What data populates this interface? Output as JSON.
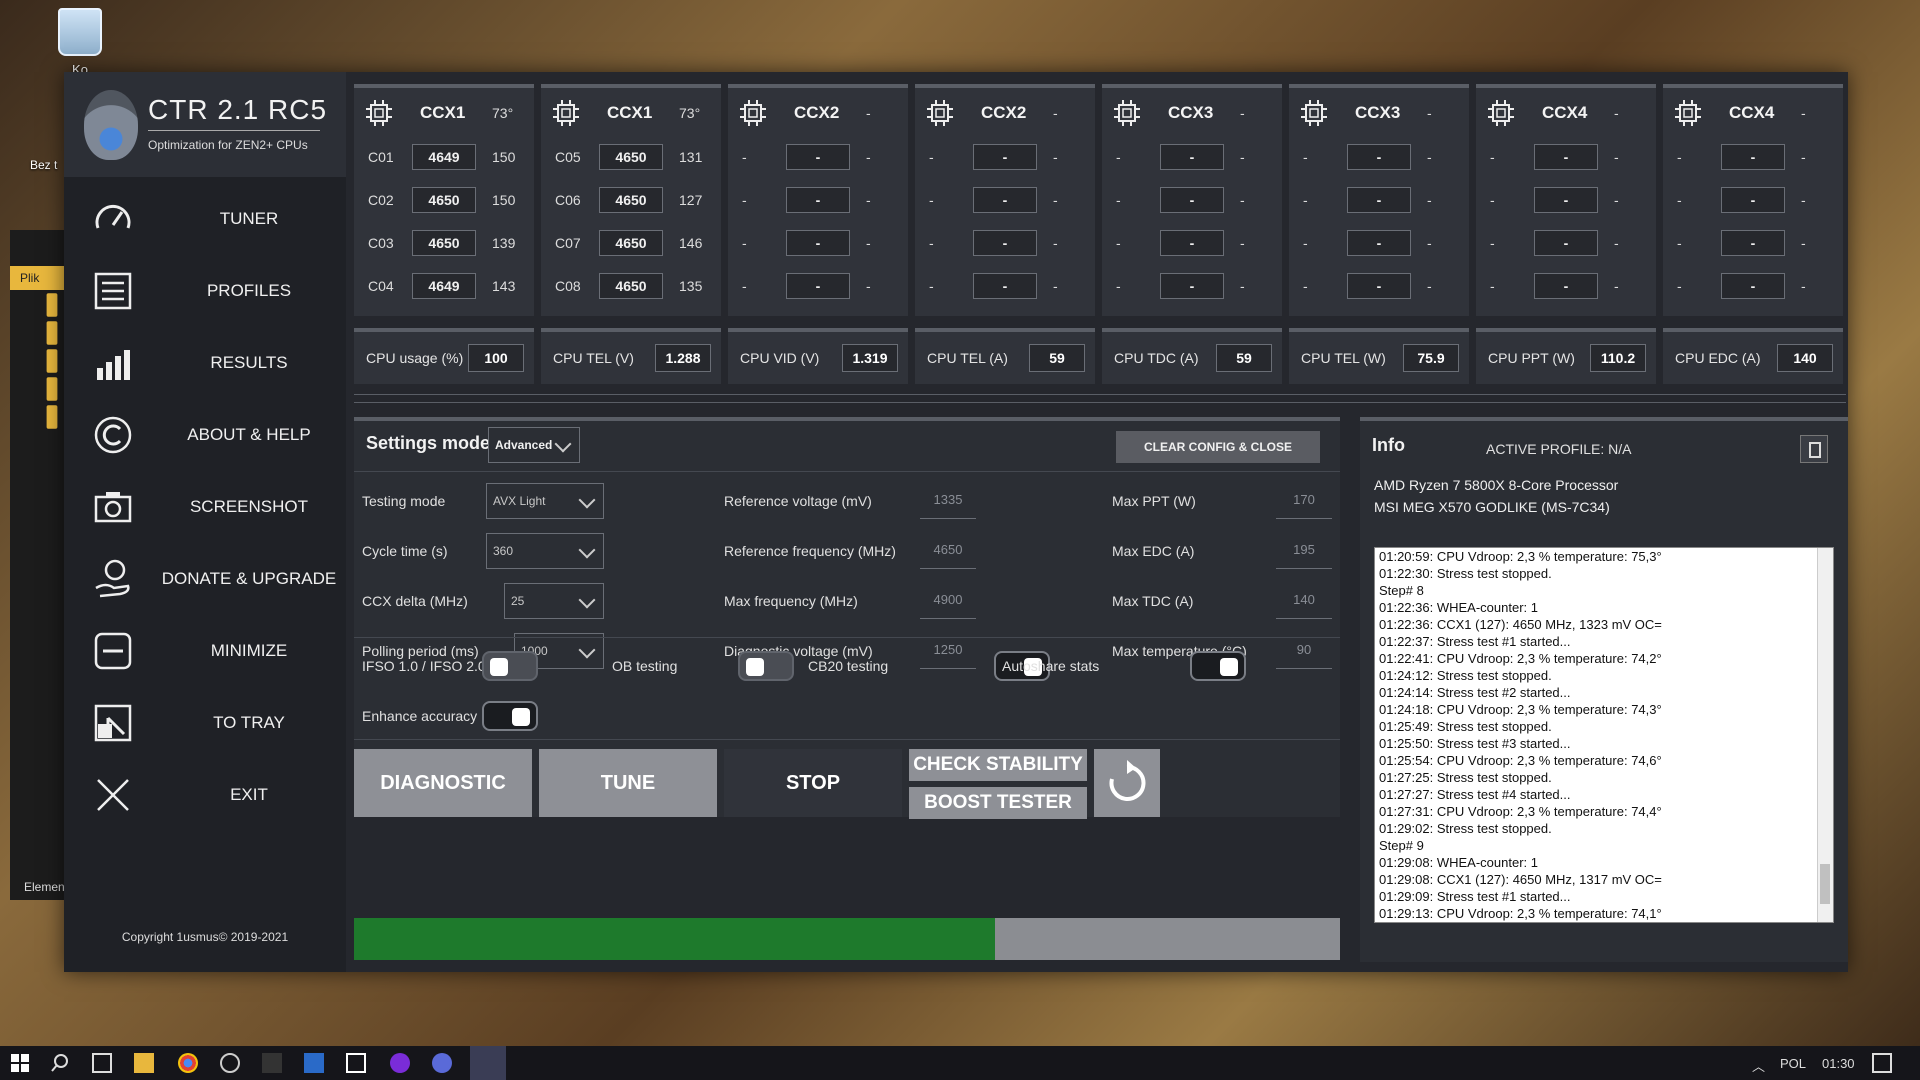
{
  "desktop": {
    "recycle_label": "Ko",
    "file_label": "Bez t",
    "explorer_tab": "Plik",
    "explorer_footer": "Elemen"
  },
  "app": {
    "title": "CTR 2.1 RC5",
    "subtitle": "Optimization for ZEN2+ CPUs",
    "nav": [
      {
        "label": "TUNER",
        "icon": "speedometer-icon"
      },
      {
        "label": "PROFILES",
        "icon": "list-icon"
      },
      {
        "label": "RESULTS",
        "icon": "bar-chart-icon"
      },
      {
        "label": "ABOUT & HELP",
        "icon": "copyright-icon"
      },
      {
        "label": "SCREENSHOT",
        "icon": "camera-icon"
      },
      {
        "label": "DONATE & UPGRADE",
        "icon": "donate-hand-icon"
      },
      {
        "label": "MINIMIZE",
        "icon": "minimize-icon"
      },
      {
        "label": "TO TRAY",
        "icon": "tray-icon"
      },
      {
        "label": "EXIT",
        "icon": "close-x-icon"
      }
    ],
    "copyright": "Copyright 1usmus© 2019-2021"
  },
  "ccx": [
    {
      "name": "CCX1",
      "temp": "73°",
      "cores": [
        {
          "id": "C01",
          "freq": "4649",
          "v": "150"
        },
        {
          "id": "C02",
          "freq": "4650",
          "v": "150"
        },
        {
          "id": "C03",
          "freq": "4650",
          "v": "139"
        },
        {
          "id": "C04",
          "freq": "4649",
          "v": "143"
        }
      ]
    },
    {
      "name": "CCX1",
      "temp": "73°",
      "cores": [
        {
          "id": "C05",
          "freq": "4650",
          "v": "131"
        },
        {
          "id": "C06",
          "freq": "4650",
          "v": "127"
        },
        {
          "id": "C07",
          "freq": "4650",
          "v": "146"
        },
        {
          "id": "C08",
          "freq": "4650",
          "v": "135"
        }
      ]
    },
    {
      "name": "CCX2",
      "temp": "-",
      "cores": [
        {
          "id": "-",
          "freq": "-",
          "v": "-"
        },
        {
          "id": "-",
          "freq": "-",
          "v": "-"
        },
        {
          "id": "-",
          "freq": "-",
          "v": "-"
        },
        {
          "id": "-",
          "freq": "-",
          "v": "-"
        }
      ]
    },
    {
      "name": "CCX2",
      "temp": "-",
      "cores": [
        {
          "id": "-",
          "freq": "-",
          "v": "-"
        },
        {
          "id": "-",
          "freq": "-",
          "v": "-"
        },
        {
          "id": "-",
          "freq": "-",
          "v": "-"
        },
        {
          "id": "-",
          "freq": "-",
          "v": "-"
        }
      ]
    },
    {
      "name": "CCX3",
      "temp": "-",
      "cores": [
        {
          "id": "-",
          "freq": "-",
          "v": "-"
        },
        {
          "id": "-",
          "freq": "-",
          "v": "-"
        },
        {
          "id": "-",
          "freq": "-",
          "v": "-"
        },
        {
          "id": "-",
          "freq": "-",
          "v": "-"
        }
      ]
    },
    {
      "name": "CCX3",
      "temp": "-",
      "cores": [
        {
          "id": "-",
          "freq": "-",
          "v": "-"
        },
        {
          "id": "-",
          "freq": "-",
          "v": "-"
        },
        {
          "id": "-",
          "freq": "-",
          "v": "-"
        },
        {
          "id": "-",
          "freq": "-",
          "v": "-"
        }
      ]
    },
    {
      "name": "CCX4",
      "temp": "-",
      "cores": [
        {
          "id": "-",
          "freq": "-",
          "v": "-"
        },
        {
          "id": "-",
          "freq": "-",
          "v": "-"
        },
        {
          "id": "-",
          "freq": "-",
          "v": "-"
        },
        {
          "id": "-",
          "freq": "-",
          "v": "-"
        }
      ]
    },
    {
      "name": "CCX4",
      "temp": "-",
      "cores": [
        {
          "id": "-",
          "freq": "-",
          "v": "-"
        },
        {
          "id": "-",
          "freq": "-",
          "v": "-"
        },
        {
          "id": "-",
          "freq": "-",
          "v": "-"
        },
        {
          "id": "-",
          "freq": "-",
          "v": "-"
        }
      ]
    }
  ],
  "stats": [
    {
      "label": "CPU usage (%)",
      "value": "100"
    },
    {
      "label": "CPU TEL (V)",
      "value": "1.288"
    },
    {
      "label": "CPU VID (V)",
      "value": "1.319"
    },
    {
      "label": "CPU TEL (A)",
      "value": "59"
    },
    {
      "label": "CPU TDC (A)",
      "value": "59"
    },
    {
      "label": "CPU TEL (W)",
      "value": "75.9"
    },
    {
      "label": "CPU PPT (W)",
      "value": "110.2"
    },
    {
      "label": "CPU EDC (A)",
      "value": "140"
    }
  ],
  "settings": {
    "title": "Settings mode",
    "mode": "Advanced",
    "clear_label": "CLEAR CONFIG & CLOSE",
    "left_fields": [
      {
        "label": "Testing mode",
        "value": "AVX Light"
      },
      {
        "label": "Cycle time (s)",
        "value": "360"
      },
      {
        "label": "CCX delta (MHz)",
        "value": "25"
      },
      {
        "label": "Polling period (ms)",
        "value": "1000"
      }
    ],
    "mid_fields": [
      {
        "label": "Reference voltage (mV)",
        "value": "1335"
      },
      {
        "label": "Reference frequency (MHz)",
        "value": "4650"
      },
      {
        "label": "Max frequency (MHz)",
        "value": "4900"
      },
      {
        "label": "Diagnostic voltage (mV)",
        "value": "1250"
      }
    ],
    "right_fields": [
      {
        "label": "Max PPT (W)",
        "value": "170"
      },
      {
        "label": "Max EDC (A)",
        "value": "195"
      },
      {
        "label": "Max TDC (A)",
        "value": "140"
      },
      {
        "label": "Max temperature (°C)",
        "value": "90"
      }
    ],
    "toggles": [
      {
        "label": "IFSO 1.0 / IFSO 2.0",
        "on": false
      },
      {
        "label": "OB testing",
        "on": false
      },
      {
        "label": "CB20 testing",
        "on": true
      },
      {
        "label": "Autoshare stats",
        "on": true
      },
      {
        "label": "Enhance accuracy",
        "on": true
      }
    ]
  },
  "actions": {
    "diagnostic": "DIAGNOSTIC",
    "tune": "TUNE",
    "stop": "STOP",
    "check_stability": "CHECK STABILITY",
    "boost_tester": "BOOST TESTER"
  },
  "progress": 0.65,
  "colors": {
    "progress_fill": "#1e7a2c",
    "progress_bg": "#8b8d92",
    "stop_bg": "#30333a"
  },
  "info": {
    "title": "Info",
    "profile": "ACTIVE PROFILE: N/A",
    "cpu": "AMD Ryzen 7 5800X 8-Core Processor",
    "board": "MSI MEG X570 GODLIKE (MS-7C34)",
    "log": [
      "01:20:59: CPU Vdroop: 2,3 % temperature: 75,3°",
      "01:22:30: Stress test stopped.",
      "Step# 8",
      "01:22:36: WHEA-counter: 1",
      "01:22:36: CCX1 (127): 4650 MHz, 1323 mV OC=",
      "01:22:37: Stress test #1 started...",
      "01:22:41: CPU Vdroop: 2,3 % temperature: 74,2°",
      "01:24:12: Stress test stopped.",
      "01:24:14: Stress test #2 started...",
      "01:24:18: CPU Vdroop: 2,3 % temperature: 74,3°",
      "01:25:49: Stress test stopped.",
      "01:25:50: Stress test #3 started...",
      "01:25:54: CPU Vdroop: 2,3 % temperature: 74,6°",
      "01:27:25: Stress test stopped.",
      "01:27:27: Stress test #4 started...",
      "01:27:31: CPU Vdroop: 2,3 % temperature: 74,4°",
      "01:29:02: Stress test stopped.",
      "Step# 9",
      "01:29:08: WHEA-counter: 1",
      "01:29:08: CCX1 (127): 4650 MHz, 1317 mV OC=",
      "01:29:09: Stress test #1 started...",
      "01:29:13: CPU Vdroop: 2,3 % temperature: 74,1°"
    ]
  },
  "taskbar": {
    "language": "POL",
    "time": "01:30"
  }
}
